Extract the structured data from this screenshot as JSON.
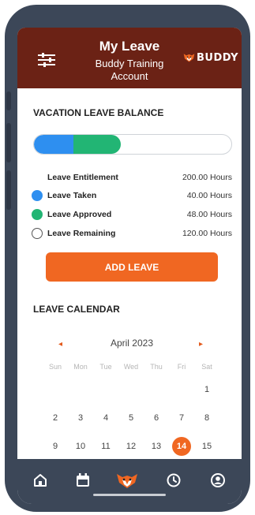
{
  "header": {
    "title": "My Leave",
    "subtitle_line1": "Buddy Training",
    "subtitle_line2": "Account",
    "logo_text": "BUDDY"
  },
  "balance": {
    "section_title": "VACATION LEAVE BALANCE",
    "bar": {
      "taken_fraction": 0.2,
      "approved_fraction": 0.24
    },
    "rows": [
      {
        "label": "Leave Entitlement",
        "value": "200.00 Hours",
        "dot": "none"
      },
      {
        "label": "Leave Taken",
        "value": "40.00 Hours",
        "dot": "#2e8ff0"
      },
      {
        "label": "Leave Approved",
        "value": "48.00 Hours",
        "dot": "#22b574"
      },
      {
        "label": "Leave Remaining",
        "value": "120.00 Hours",
        "dot": "outline"
      }
    ]
  },
  "add_button_label": "ADD LEAVE",
  "calendar": {
    "section_title": "LEAVE CALENDAR",
    "month": "April 2023",
    "prev": "◂",
    "next": "▸",
    "weekdays": [
      "Sun",
      "Mon",
      "Tue",
      "Wed",
      "Thu",
      "Fri",
      "Sat"
    ],
    "days": [
      "1",
      "2",
      "3",
      "4",
      "5",
      "6",
      "7",
      "8",
      "9",
      "10",
      "11",
      "12",
      "13",
      "14",
      "15"
    ],
    "selected_day": "14"
  },
  "bottom_nav": [
    "home-icon",
    "calendar-icon",
    "buddy-logo-icon",
    "clock-icon",
    "profile-icon"
  ],
  "colors": {
    "header": "#6b2215",
    "accent": "#f06722",
    "taken": "#2e8ff0",
    "approved": "#22b574",
    "frame": "#3c4758"
  }
}
